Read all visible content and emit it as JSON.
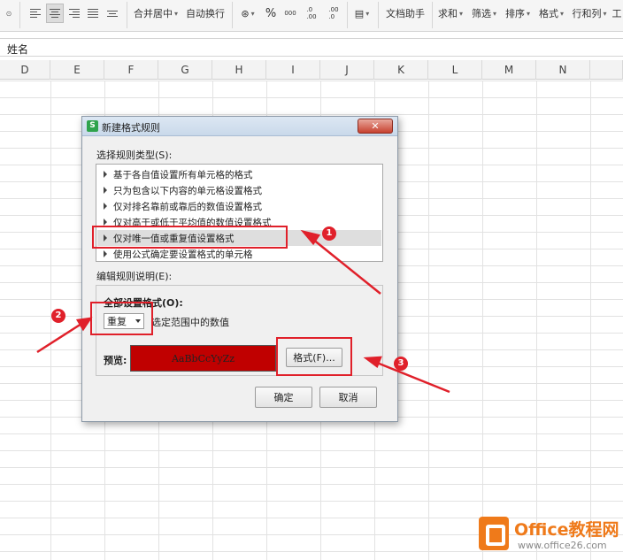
{
  "ribbon": {
    "merge_center": "合并居中",
    "auto_wrap": "自动换行",
    "percent_symbol": "%",
    "decimal_increase": ".0\n.00",
    "decimal_decrease": ".00\n.0",
    "doc_helper": "文档助手",
    "sum": "求和",
    "filter": "筛选",
    "sort": "排序",
    "format": "格式",
    "row_col": "行和列",
    "tools_cut": "工"
  },
  "formula_bar": {
    "value": "姓名"
  },
  "columns": [
    "D",
    "E",
    "F",
    "G",
    "H",
    "I",
    "J",
    "K",
    "L",
    "M",
    "N"
  ],
  "dialog": {
    "title": "新建格式规则",
    "close_symbol": "✕",
    "rule_type_label": "选择规则类型(S):",
    "rule_types": [
      "基于各自值设置所有单元格的格式",
      "只为包含以下内容的单元格设置格式",
      "仅对排名靠前或靠后的数值设置格式",
      "仅对高于或低于平均值的数值设置格式",
      "仅对唯一值或重复值设置格式",
      "使用公式确定要设置格式的单元格"
    ],
    "selected_index": 4,
    "edit_label": "编辑规则说明(E):",
    "format_all_label": "全部设置格式(O):",
    "select_value": "重复",
    "select_suffix": "选定范围中的数值",
    "preview_label": "预览:",
    "preview_text": "AaBbCcYyZz",
    "preview_bg": "#c00000",
    "format_button": "格式(F)...",
    "ok_button": "确定",
    "cancel_button": "取消"
  },
  "annotations": {
    "badge1": "1",
    "badge2": "2",
    "badge3": "3",
    "color": "#e0202a"
  },
  "watermark": {
    "title": "Office教程网",
    "url": "www.office26.com"
  }
}
